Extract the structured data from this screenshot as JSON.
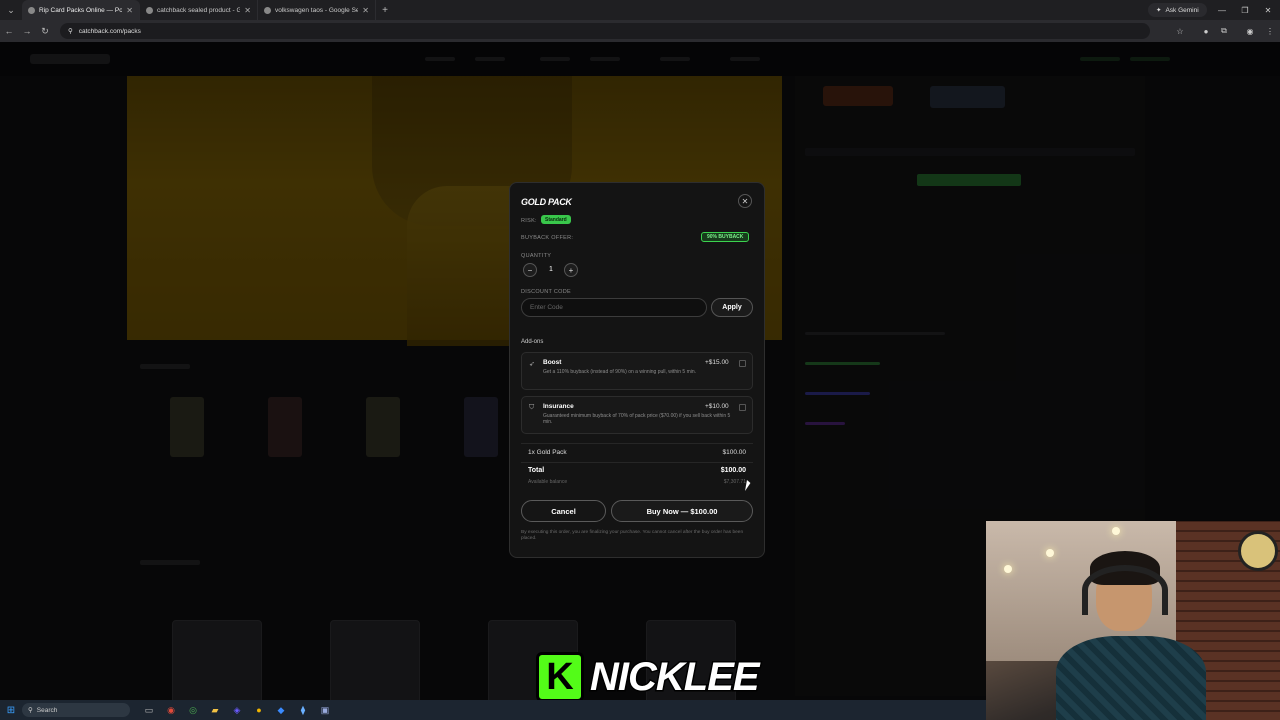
{
  "browser": {
    "tabs": [
      {
        "title": "Rip Card Packs Online — Poké"
      },
      {
        "title": "catchback sealed product - Go"
      },
      {
        "title": "volkswagen taos - Google Sear"
      }
    ],
    "new_tab": "+",
    "gemini_label": "Ask Gemini",
    "url": "catchback.com/packs"
  },
  "modal": {
    "title": "GOLD PACK",
    "risk_label": "RISK:",
    "risk_value": "Standard",
    "buyback_label": "BUYBACK OFFER:",
    "buyback_value": "90% BUYBACK",
    "quantity_label": "QUANTITY",
    "quantity_minus": "−",
    "quantity_value": "1",
    "quantity_plus": "+",
    "discount_label": "DISCOUNT CODE",
    "discount_placeholder": "Enter Code",
    "apply_label": "Apply",
    "addons_heading": "Add-ons",
    "addons": [
      {
        "name": "Boost",
        "price": "+$15.00",
        "description": "Get a 110% buyback (instead of 90%) on a winning pull, within 5 min."
      },
      {
        "name": "Insurance",
        "price": "+$10.00",
        "description": "Guaranteed minimum buyback of 70% of pack price ($70.00) if you sell back within 5 min."
      }
    ],
    "summary": {
      "line_item": "1x Gold Pack",
      "line_price": "$100.00",
      "total_label": "Total",
      "total_value": "$100.00",
      "balance_label": "Available balance",
      "balance_value": "$7,307.71"
    },
    "cancel_label": "Cancel",
    "buy_label": "Buy Now — $100.00",
    "disclaimer": "By executing this order, you are finalizing your purchase. You cannot cancel after the buy order has been placed."
  },
  "streamer": {
    "logo_letter": "K",
    "name": "NICKLEE"
  },
  "taskbar": {
    "search_placeholder": "Search"
  },
  "colors": {
    "accent_green": "#39c74b",
    "hero_gold": "#8a6a08",
    "kick_green": "#53fc18"
  }
}
